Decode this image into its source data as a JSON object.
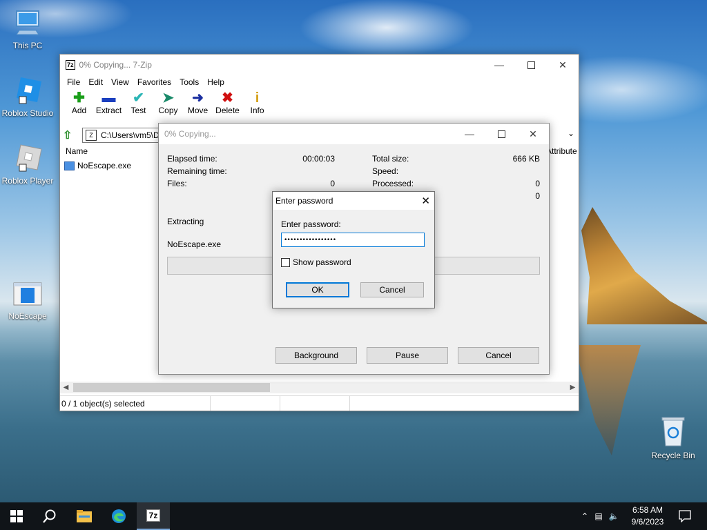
{
  "desktop": {
    "icons": [
      {
        "label": "This PC"
      },
      {
        "label": "Roblox Studio"
      },
      {
        "label": "Roblox Player"
      },
      {
        "label": "NoEscape"
      },
      {
        "label": "Recycle Bin"
      }
    ]
  },
  "zip_window": {
    "title": "0% Copying... 7-Zip",
    "app_icon": "7z",
    "menu": [
      "File",
      "Edit",
      "View",
      "Favorites",
      "Tools",
      "Help"
    ],
    "toolbar": [
      {
        "label": "Add",
        "icon": "plus-icon",
        "color": "#1a9e1a"
      },
      {
        "label": "Extract",
        "icon": "minus-icon",
        "color": "#1b3fbf"
      },
      {
        "label": "Test",
        "icon": "check-icon",
        "color": "#2bb5b5"
      },
      {
        "label": "Copy",
        "icon": "copy-arrow-icon",
        "color": "#1a8a6a"
      },
      {
        "label": "Move",
        "icon": "move-arrow-icon",
        "color": "#1b2fa0"
      },
      {
        "label": "Delete",
        "icon": "delete-x-icon",
        "color": "#d01010"
      },
      {
        "label": "Info",
        "icon": "info-icon",
        "color": "#d4a017"
      }
    ],
    "address": "C:\\Users\\vm5\\De",
    "columns": {
      "name": "Name",
      "attributes": "Attribute"
    },
    "files": [
      {
        "name": "NoEscape.exe"
      }
    ],
    "status": "0 / 1 object(s) selected"
  },
  "progress_dialog": {
    "title": "0% Copying...",
    "elapsed_label": "Elapsed time:",
    "elapsed_value": "00:00:03",
    "remaining_label": "Remaining time:",
    "files_label": "Files:",
    "files_value": "0",
    "total_size_label": "Total size:",
    "total_size_value": "666 KB",
    "speed_label": "Speed:",
    "processed_label": "Processed:",
    "processed_value": "0",
    "extra_value": "0",
    "operation": "Extracting",
    "current_file": "NoEscape.exe",
    "progress_fraction": 0,
    "buttons": {
      "background": "Background",
      "pause": "Pause",
      "cancel": "Cancel"
    }
  },
  "password_dialog": {
    "title": "Enter password",
    "label": "Enter password:",
    "value": "•••••••••••••••••",
    "show_password": "Show password",
    "show_password_checked": false,
    "ok": "OK",
    "cancel": "Cancel"
  },
  "taskbar": {
    "pinned": [
      {
        "name": "start-icon"
      },
      {
        "name": "search-icon"
      },
      {
        "name": "file-explorer-icon"
      },
      {
        "name": "edge-icon"
      },
      {
        "name": "7zip-icon",
        "label": "7z",
        "active": true
      }
    ],
    "time": "6:58 AM",
    "date": "9/6/2023"
  }
}
